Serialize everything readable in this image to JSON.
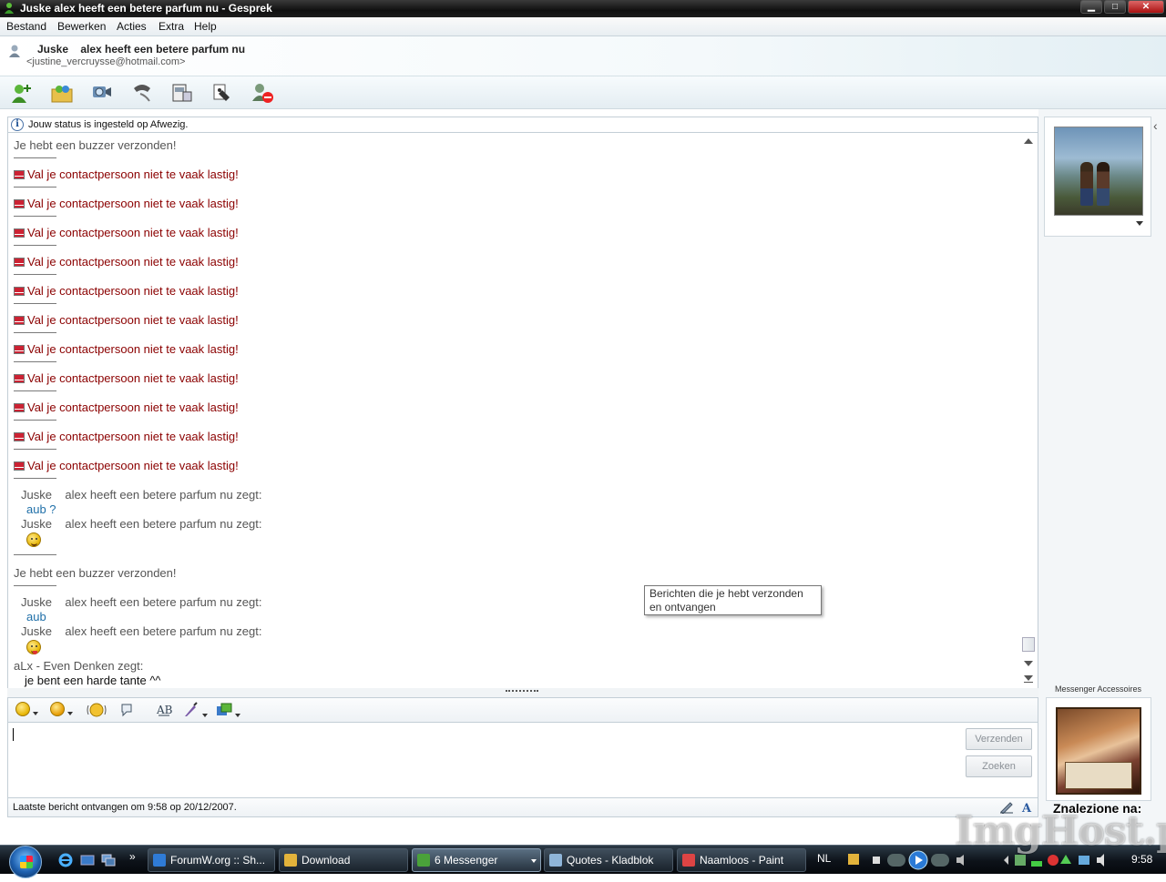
{
  "window": {
    "title": "Juske  alex heeft een betere parfum nu - Gesprek",
    "buttons": [
      "minimize",
      "maximize",
      "close"
    ]
  },
  "menu": [
    "Bestand",
    "Bewerken",
    "Acties",
    "Extra",
    "Help"
  ],
  "contact": {
    "name_line": "Juske    alex heeft een betere parfum nu",
    "email": "<justine_vercruysse@hotmail.com>"
  },
  "toolbar_icons": [
    "invite-contact-icon",
    "share-folder-icon",
    "webcam-icon",
    "phone-call-icon",
    "video-icon",
    "games-icon",
    "block-contact-icon"
  ],
  "status_notice": "Jouw status is ingesteld op Afwezig.",
  "conversation": {
    "buzzer_text": "Je hebt een buzzer verzonden!",
    "warning_text": "Val je contactpersoon niet te vaak lastig!",
    "sender_says": "Juske    alex heeft een betere parfum nu zegt:",
    "replies": [
      "aub ?",
      "aub"
    ],
    "own_sender": "aLx - Even Denken zegt:",
    "own_message": "je bent een harde tante ^^",
    "tooltip": "Berichten die je hebt verzonden en ontvangen"
  },
  "input": {
    "send_label": "Verzenden",
    "search_label": "Zoeken",
    "tool_icons": [
      "emoticon-icon",
      "wink-icon",
      "nudge-icon",
      "voice-clip-icon",
      "font-icon",
      "background-icon",
      "share-icon"
    ]
  },
  "last_message": "Laatste bericht ontvangen om 9:58 op 20/12/2007.",
  "side": {
    "accessories_label": "Messenger Accessoires",
    "znalezione": "Znalezione na:"
  },
  "taskbar": {
    "items": [
      {
        "label": "ForumW.org :: Sh...",
        "icon": "ie-icon",
        "color": "#2f7bd6",
        "active": false
      },
      {
        "label": "Download",
        "icon": "folder-icon",
        "color": "#e3b33b",
        "active": false
      },
      {
        "label": "6 Messenger",
        "icon": "messenger-icon",
        "color": "#4aa23a",
        "active": true
      },
      {
        "label": "Quotes - Kladblok",
        "icon": "notepad-icon",
        "color": "#8fb5d8",
        "active": false
      },
      {
        "label": "Naamloos - Paint",
        "icon": "paint-icon",
        "color": "#d44",
        "active": false
      }
    ],
    "language": "NL",
    "clock": "9:58"
  },
  "watermark": "ImgHost.pl",
  "colors": {
    "warning": "#8b0000",
    "reply": "#1f6fa8",
    "titlebar": "#101010"
  }
}
